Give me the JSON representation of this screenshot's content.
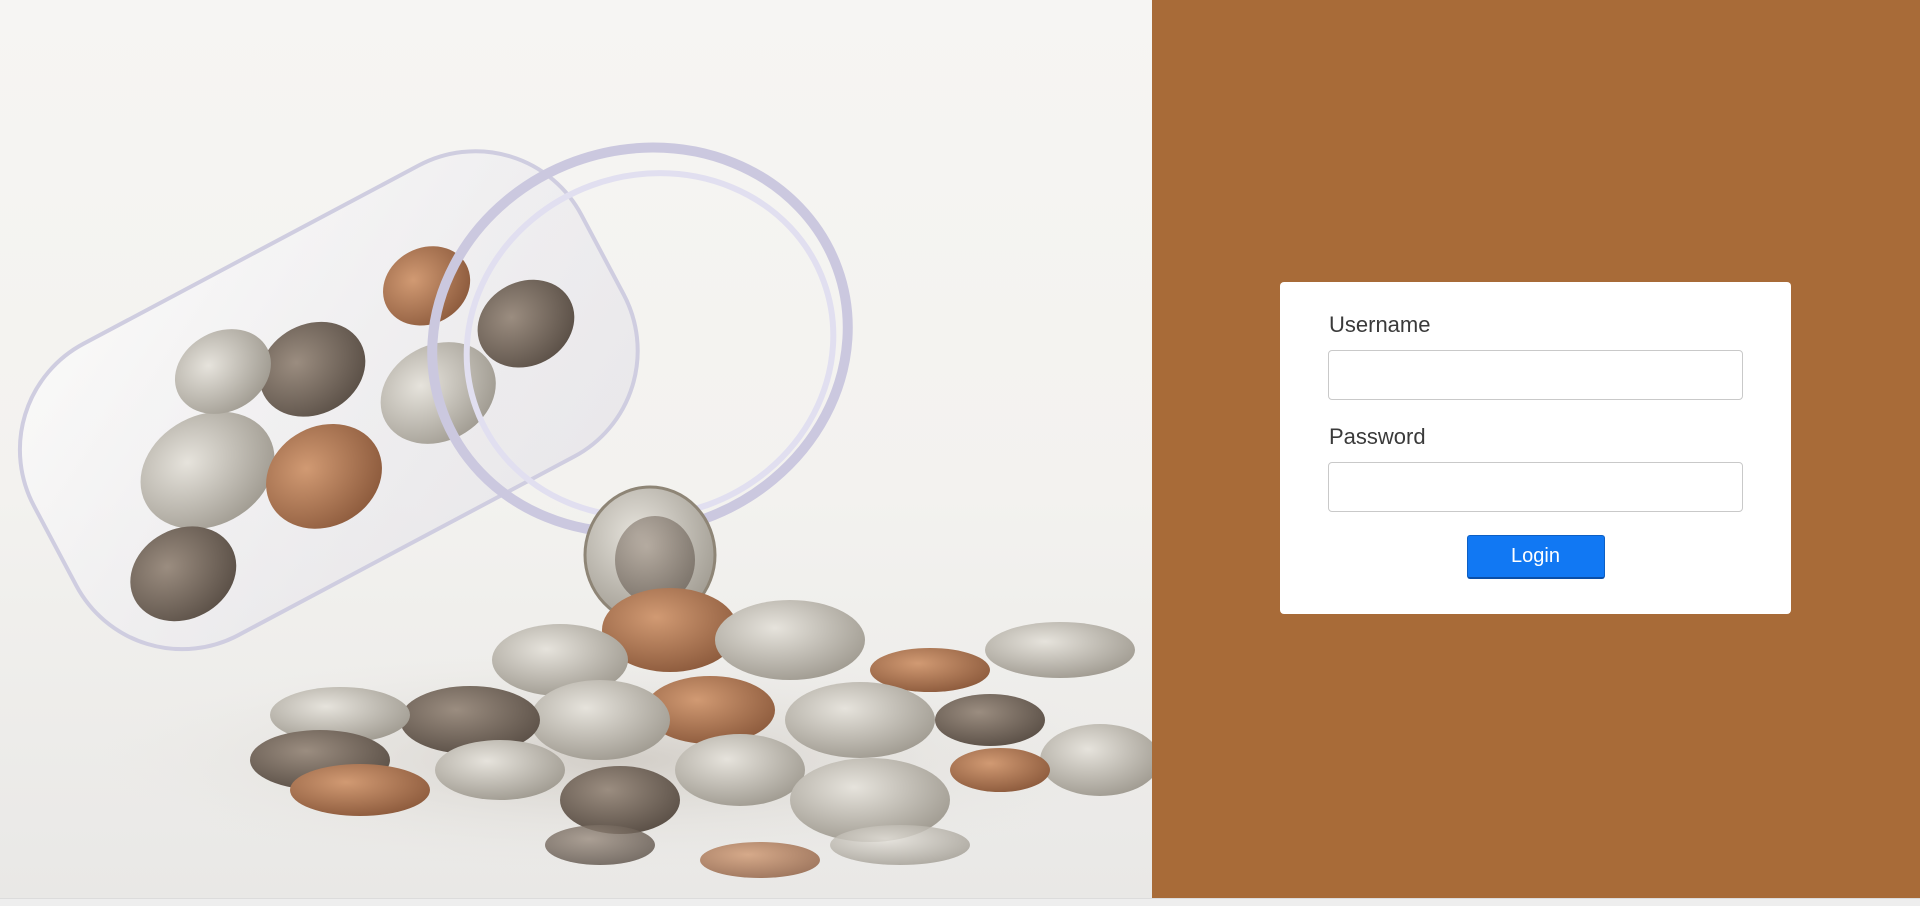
{
  "hero": {
    "image_description": "coin-jar-icon"
  },
  "colors": {
    "side_panel": "#a86b38",
    "button": "#1178f3",
    "card": "#ffffff"
  },
  "login": {
    "username_label": "Username",
    "username_value": "",
    "password_label": "Password",
    "password_value": "",
    "button_label": "Login"
  }
}
